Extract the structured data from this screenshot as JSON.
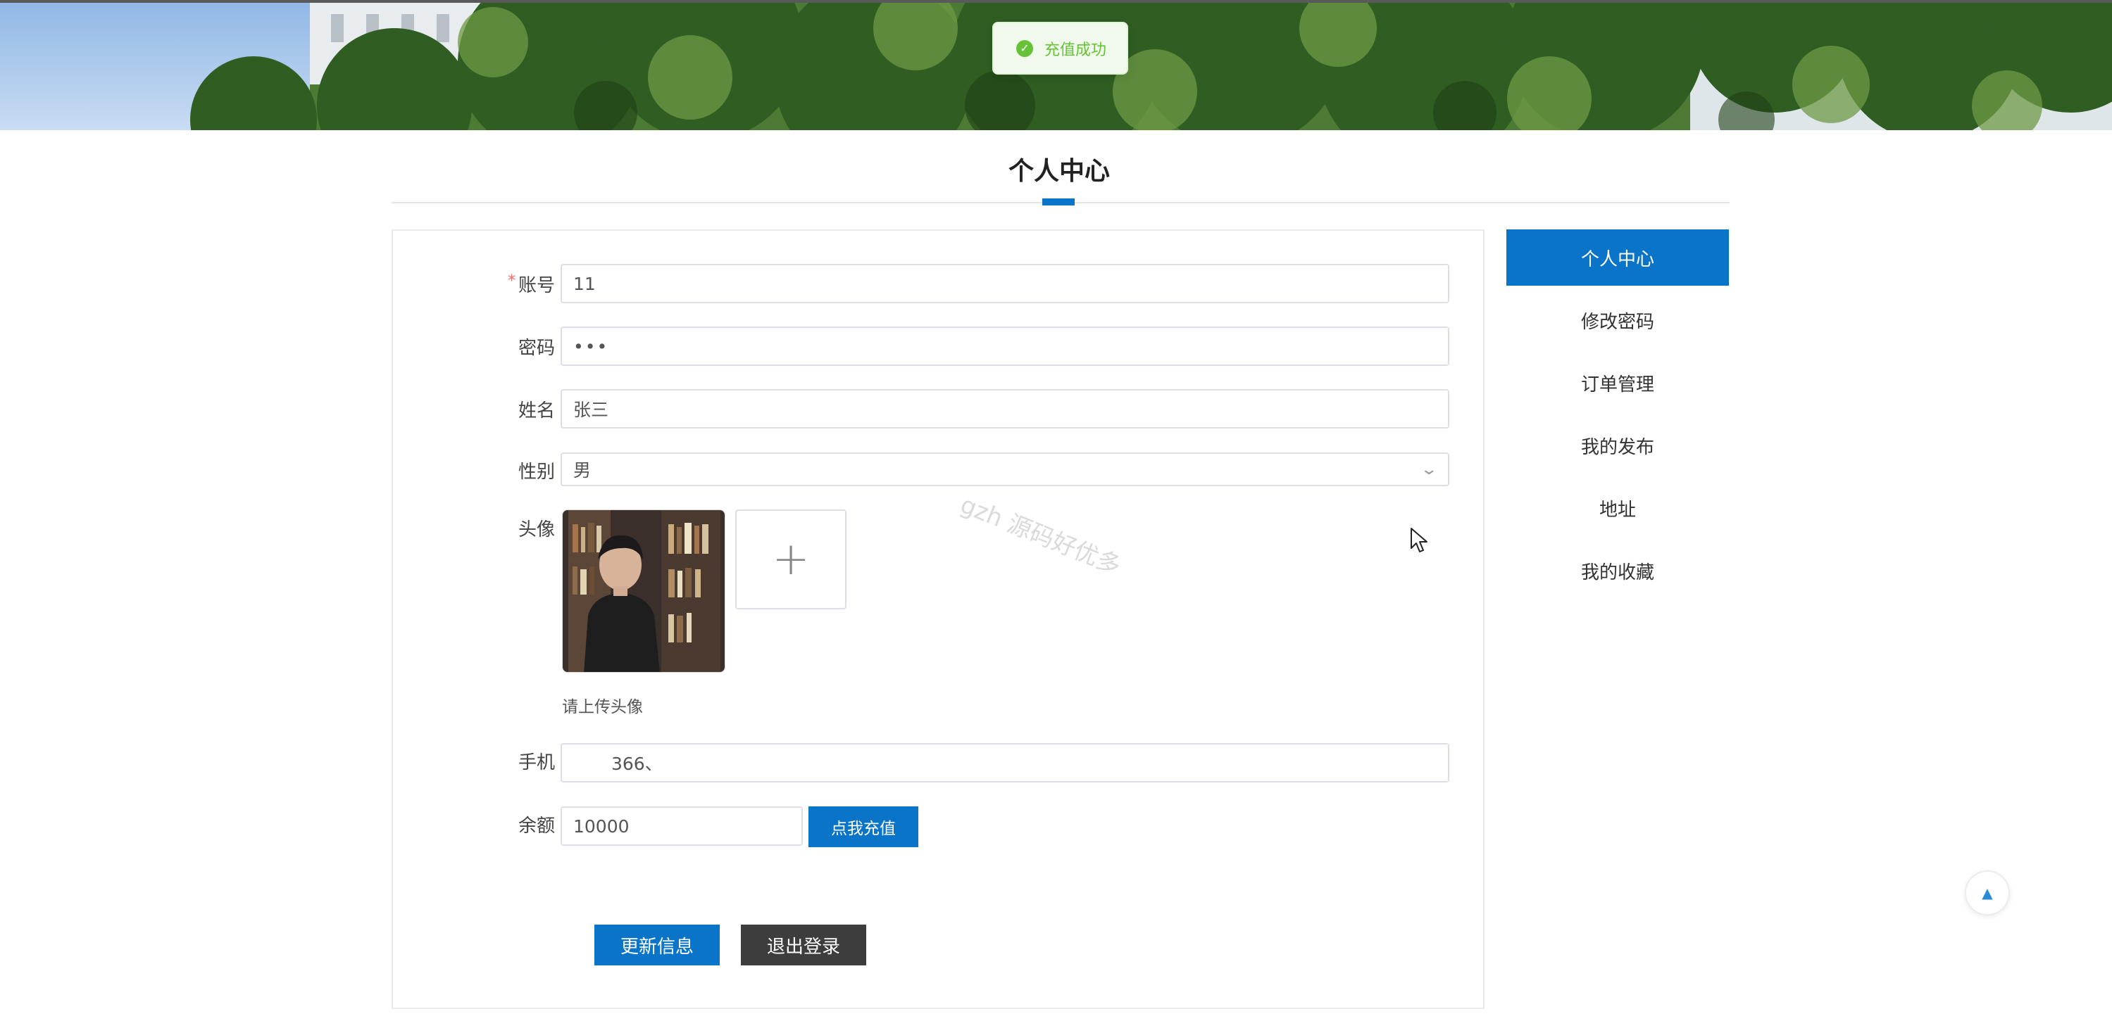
{
  "toast": {
    "message": "充值成功",
    "icon": "check-circle-icon",
    "color": "#67c23a"
  },
  "page": {
    "title": "个人中心",
    "accent": "#0a74c9"
  },
  "form": {
    "account": {
      "label": "账号",
      "value": "11",
      "required_mark": "*"
    },
    "password": {
      "label": "密码",
      "value": "•••"
    },
    "name": {
      "label": "姓名",
      "value": "张三"
    },
    "gender": {
      "label": "性别",
      "value": "男",
      "icon": "chevron-down-icon"
    },
    "avatar": {
      "label": "头像",
      "hint": "请上传头像",
      "upload_icon": "plus-icon"
    },
    "phone": {
      "label": "手机",
      "value": "366、"
    },
    "balance": {
      "label": "余额",
      "value": "10000",
      "recharge_label": "点我充值"
    },
    "update_label": "更新信息",
    "logout_label": "退出登录"
  },
  "watermark": "gzh 源码好优多",
  "sidebar": {
    "items": [
      {
        "label": "个人中心",
        "active": true
      },
      {
        "label": "修改密码",
        "active": false
      },
      {
        "label": "订单管理",
        "active": false
      },
      {
        "label": "我的发布",
        "active": false
      },
      {
        "label": "地址",
        "active": false
      },
      {
        "label": "我的收藏",
        "active": false
      }
    ]
  },
  "back_to_top": {
    "icon": "caret-up-icon"
  }
}
